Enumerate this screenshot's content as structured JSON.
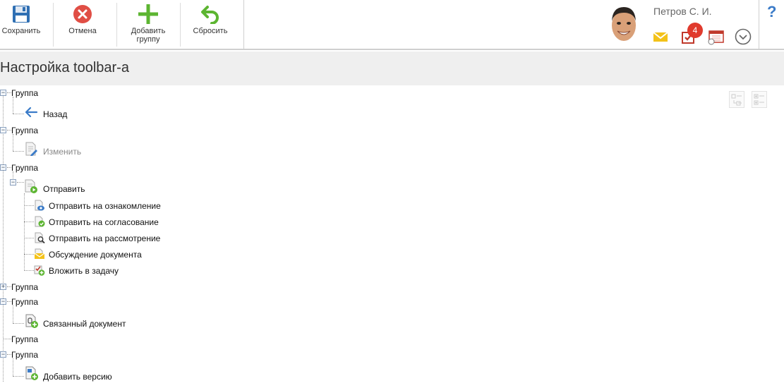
{
  "toolbar": {
    "save_label": "Сохранить",
    "cancel_label": "Отмена",
    "add_group_label": "Добавить группу",
    "reset_label": "Сбросить"
  },
  "header": {
    "user_name": "Петров С. И.",
    "tasks_badge": "4",
    "help_label": "?"
  },
  "page": {
    "title": "Настройка toolbar-а"
  },
  "tree": {
    "groups": [
      {
        "label": "Группа",
        "items": [
          {
            "label": "Назад",
            "icon": "back-arrow-icon"
          }
        ]
      },
      {
        "label": "Группа",
        "items": [
          {
            "label": "Изменить",
            "icon": "edit-document-icon",
            "disabled": true
          }
        ]
      },
      {
        "label": "Группа",
        "items": [
          {
            "label": "Отправить",
            "icon": "send-document-icon",
            "children": [
              {
                "label": "Отправить на ознакомление",
                "icon": "send-review-icon"
              },
              {
                "label": "Отправить на согласование",
                "icon": "send-approval-icon"
              },
              {
                "label": "Отправить на рассмотрение",
                "icon": "send-consideration-icon"
              },
              {
                "label": "Обсуждение документа",
                "icon": "discussion-icon"
              },
              {
                "label": "Вложить в задачу",
                "icon": "attach-task-icon"
              }
            ]
          }
        ]
      },
      {
        "label": "Группа",
        "items": []
      },
      {
        "label": "Группа",
        "items": [
          {
            "label": "Связанный документ",
            "icon": "linked-document-icon"
          }
        ]
      },
      {
        "label": "Группа",
        "items": []
      },
      {
        "label": "Группа",
        "items": [
          {
            "label": "Добавить версию",
            "icon": "add-version-icon"
          }
        ]
      }
    ]
  },
  "colors": {
    "accent_blue": "#3a7bc8",
    "badge_red": "#e03a2d",
    "add_green": "#5cb531",
    "cancel_red": "#e04e45"
  }
}
